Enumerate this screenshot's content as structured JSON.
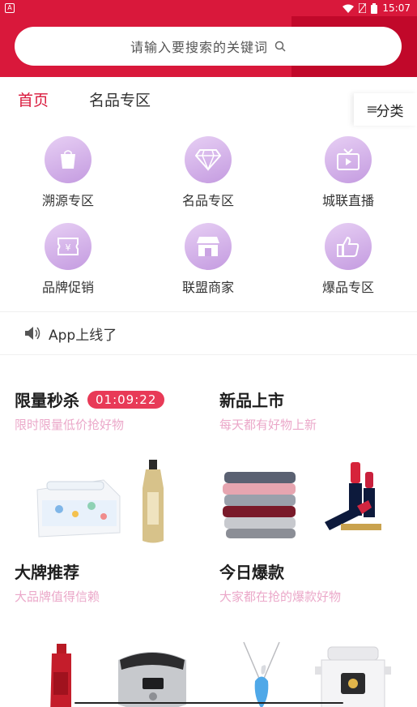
{
  "status_bar": {
    "time": "15:07",
    "app_badge": "A"
  },
  "search": {
    "placeholder": "请输入要搜索的关键词"
  },
  "tabs": {
    "home": "首页",
    "brand": "名品专区",
    "category": "分类"
  },
  "grid": [
    {
      "label": "溯源专区",
      "icon": "shopping-bag-icon"
    },
    {
      "label": "名品专区",
      "icon": "diamond-icon"
    },
    {
      "label": "城联直播",
      "icon": "tv-icon"
    },
    {
      "label": "品牌促销",
      "icon": "coupon-icon"
    },
    {
      "label": "联盟商家",
      "icon": "store-icon"
    },
    {
      "label": "爆品专区",
      "icon": "thumbs-up-icon"
    }
  ],
  "notice": {
    "text": "App上线了"
  },
  "cards": [
    {
      "title": "限量秒杀",
      "countdown": "01:09:22",
      "subtitle": "限时限量低价抢好物"
    },
    {
      "title": "新品上市",
      "subtitle": "每天都有好物上新"
    },
    {
      "title": "大牌推荐",
      "subtitle": "大品牌值得信赖"
    },
    {
      "title": "今日爆款",
      "subtitle": "大家都在抢的爆款好物"
    }
  ],
  "colors": {
    "brand_red": "#d9183b",
    "subtitle_pink": "#eba8c9",
    "countdown_red": "#e83a57"
  }
}
